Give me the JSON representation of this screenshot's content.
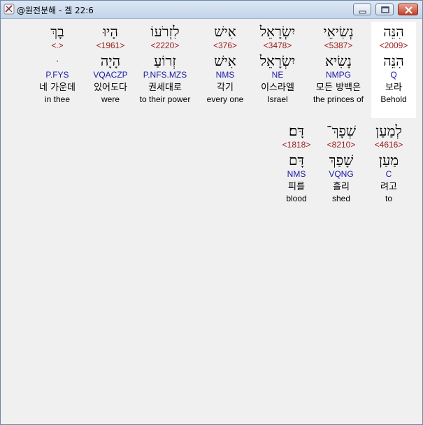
{
  "window": {
    "title": "@원전분해 - 겔 22:6"
  },
  "rows": [
    {
      "words": [
        {
          "hebrew": "הִנֵּה",
          "strong": "<2009>",
          "root": "הִנֵּה",
          "parse": "Q",
          "korean": "보라",
          "english": "Behold",
          "highlighted": true
        },
        {
          "hebrew": "נְשִׂיאֵי",
          "strong": "<5387>",
          "root": "נָשִׂיא",
          "parse": "NMPG",
          "korean": "모든 방백은",
          "english": "the princes of"
        },
        {
          "hebrew": "יִשְׂרָאֵל",
          "strong": "<3478>",
          "root": "יִשְׂרָאֵל",
          "parse": "NE",
          "korean": "이스라엘",
          "english": "Israel"
        },
        {
          "hebrew": "אִישׁ",
          "strong": "<376>",
          "root": "אִישׁ",
          "parse": "NMS",
          "korean": "각기",
          "english": "every one"
        },
        {
          "hebrew": "לִזְרֹעוֹ",
          "strong": "<2220>",
          "root": "זְרוֹעַ",
          "parse": "P.NFS.MZS",
          "korean": "권세대로",
          "english": "to their power"
        },
        {
          "hebrew": "הָיוּ",
          "strong": "<1961>",
          "root": "הָיָה",
          "parse": "VQACZP",
          "korean": "있어도다",
          "english": "were"
        },
        {
          "hebrew": "בָךְ",
          "strong": "<.>",
          "root": "ּ",
          "parse": "P.FYS",
          "korean": "네 가운데",
          "english": "in thee"
        }
      ]
    },
    {
      "words": [
        {
          "hebrew": "לְמַעַן",
          "strong": "<4616>",
          "root": "מַעַן",
          "parse": "C",
          "korean": "려고",
          "english": "to"
        },
        {
          "hebrew": "שְׁפָךְ־",
          "strong": "<8210>",
          "root": "שָׁפַךְ",
          "parse": "VQNG",
          "korean": "흘리",
          "english": "shed"
        },
        {
          "hebrew": "דָּם׃",
          "strong": "<1818>",
          "root": "דָּם",
          "parse": "NMS",
          "korean": "피를",
          "english": "blood"
        }
      ]
    }
  ],
  "colors": {
    "strong": "#9b1a1a",
    "parse": "#1a1aa6",
    "highlight_bg": "#ffffff"
  },
  "icons": {
    "app": "interlinear-app-icon",
    "minimize": "minimize-icon",
    "maximize": "maximize-icon",
    "close": "close-icon"
  }
}
